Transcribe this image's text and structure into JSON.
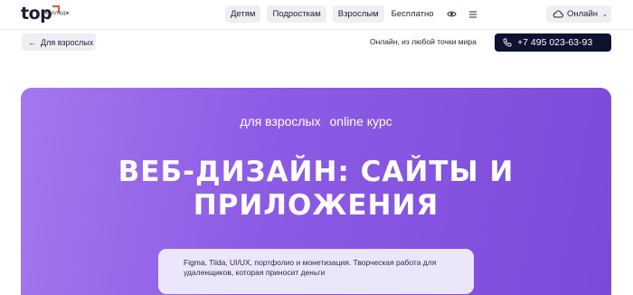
{
  "header": {
    "logo_word": "top",
    "logo_sub": "колледж",
    "nav": [
      {
        "label": "Детям"
      },
      {
        "label": "Подросткам"
      },
      {
        "label": "Взрослым"
      }
    ],
    "nav_free": "Бесплатно",
    "lang_label": "Онлайн",
    "icons": [
      "eye-icon",
      "menu-icon",
      "cloud-icon",
      "chevron-down-icon"
    ]
  },
  "subbar": {
    "back_label": "Для взрослых",
    "location": "Онлайн, из любой точки мира",
    "phone": "+7 495 023-63-93",
    "icons": [
      "arrow-left-icon",
      "phone-icon"
    ]
  },
  "hero": {
    "tag_audience": "для взрослых",
    "tag_format": "online курс",
    "title_line1": "ВЕБ-ДИЗАЙН: САЙТЫ И",
    "title_line2": "ПРИЛОЖЕНИЯ",
    "description": "Figma, Tilda, UI/UX, портфолио и монетизация. Творческая работа для удаленщиков, которая приносит деньги",
    "colors": {
      "gradient_start": "#a378ee",
      "gradient_end": "#7b4ad9",
      "phone_bg": "#0e1130",
      "logo_accent": "#f0503c"
    }
  }
}
